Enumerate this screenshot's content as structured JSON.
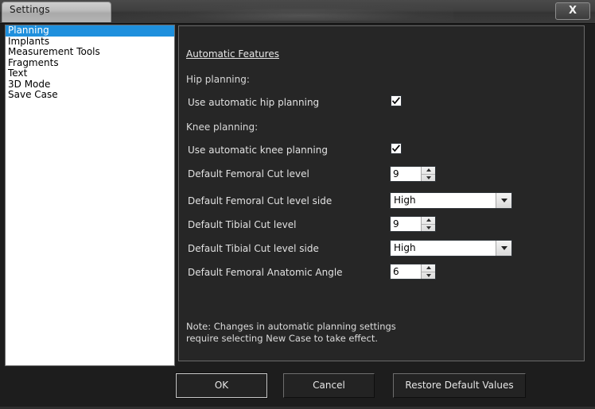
{
  "window": {
    "title": "Settings",
    "close_label": "X",
    "accent_selection_color": "#1f90dd",
    "panel_background_color": "#262626"
  },
  "sidebar": {
    "items": [
      {
        "label": "Planning",
        "selected": true
      },
      {
        "label": "Implants",
        "selected": false
      },
      {
        "label": "Measurement Tools",
        "selected": false
      },
      {
        "label": "Fragments",
        "selected": false
      },
      {
        "label": "Text",
        "selected": false
      },
      {
        "label": "3D Mode",
        "selected": false
      },
      {
        "label": "Save Case",
        "selected": false
      }
    ]
  },
  "panel": {
    "heading": "Automatic Features",
    "hip_group_label": "Hip planning:",
    "knee_group_label": "Knee planning:",
    "fields": {
      "use_auto_hip": {
        "label": "Use automatic hip planning",
        "checked": true
      },
      "use_auto_knee": {
        "label": "Use automatic knee planning",
        "checked": true
      },
      "femoral_cut_level": {
        "label": "Default Femoral Cut level",
        "value": "9"
      },
      "femoral_cut_level_side": {
        "label": "Default Femoral Cut level side",
        "value": "High"
      },
      "tibial_cut_level": {
        "label": "Default Tibial Cut level",
        "value": "9"
      },
      "tibial_cut_level_side": {
        "label": "Default Tibial Cut level side",
        "value": "High"
      },
      "femoral_anatomic_angle": {
        "label": "Default Femoral Anatomic Angle",
        "value": "6"
      }
    },
    "note_line1": "Note: Changes in automatic planning settings",
    "note_line2": "require selecting New Case to take effect."
  },
  "buttons": {
    "ok": "OK",
    "cancel": "Cancel",
    "restore": "Restore Default Values"
  }
}
